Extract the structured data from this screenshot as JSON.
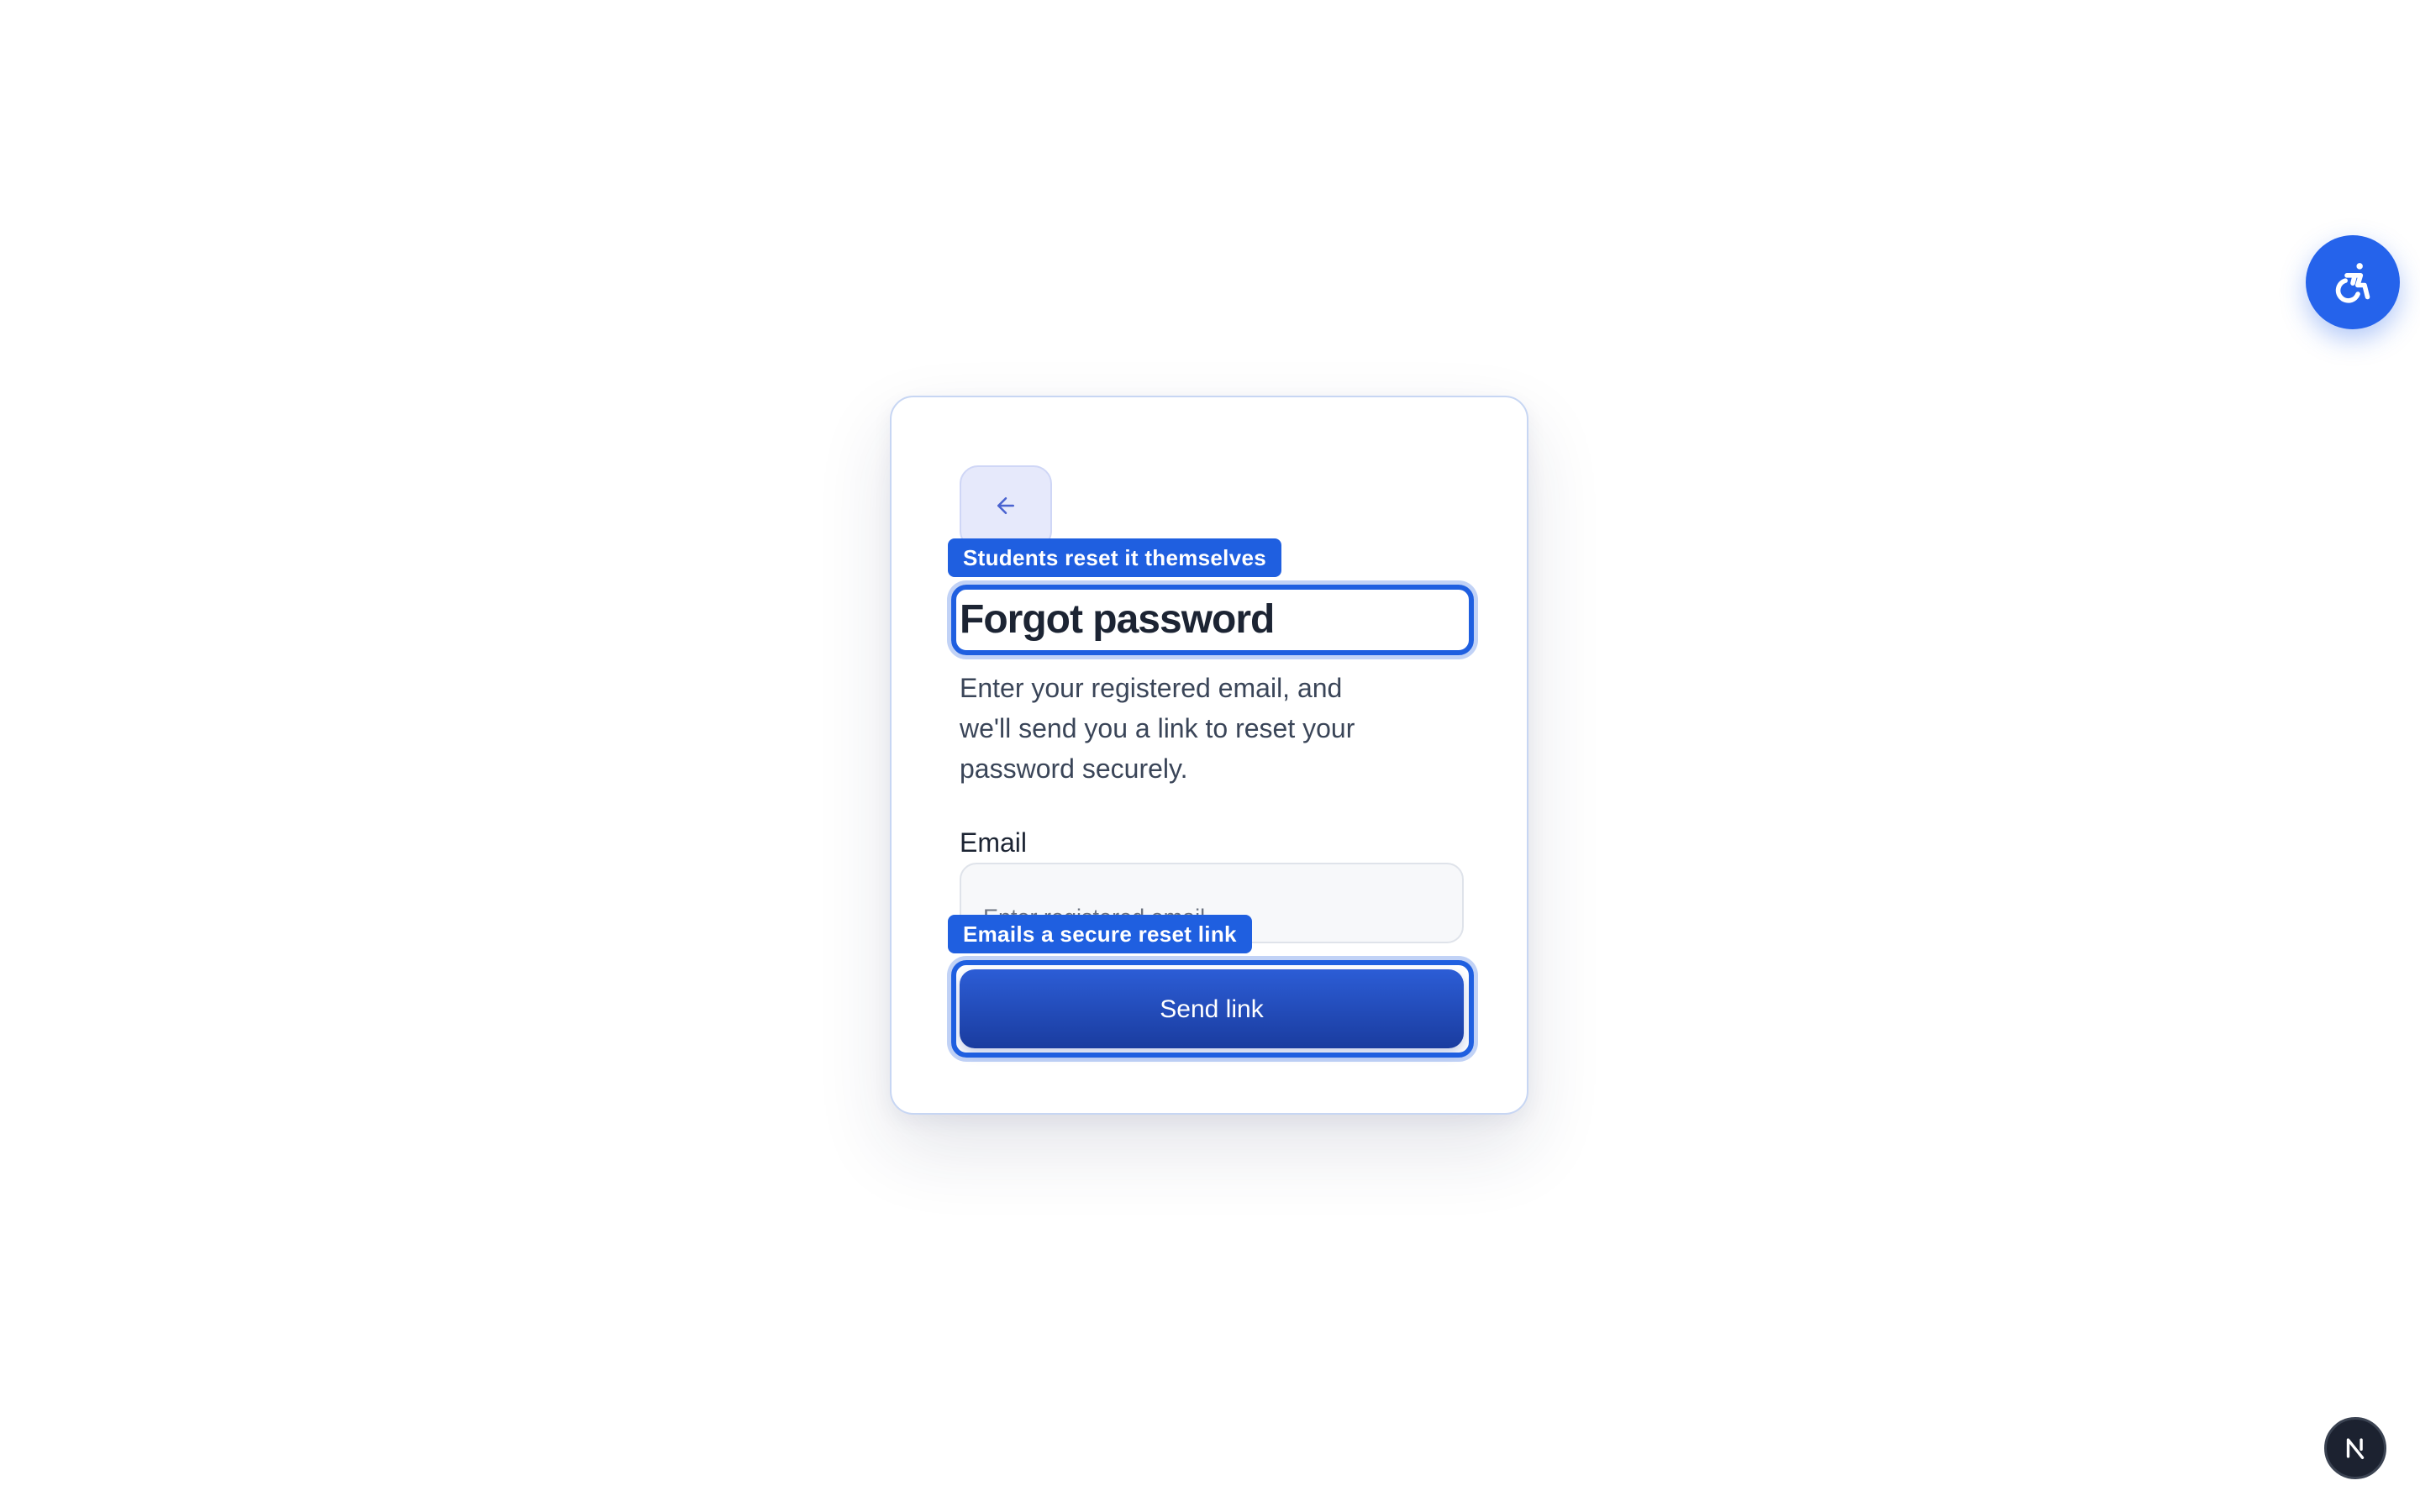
{
  "card": {
    "back_icon": "arrow-left-icon",
    "title": "Forgot password",
    "description": "Enter your registered email, and we'll send you a link to reset your password securely.",
    "email_label": "Email",
    "email_placeholder": "Enter registered email",
    "email_value": "",
    "submit_label": "Send link"
  },
  "annotations": {
    "title_badge": "Students reset it themselves",
    "button_badge": "Emails a secure reset link"
  },
  "floating": {
    "accessibility_icon": "accessibility-icon",
    "next_icon": "next-logo-icon"
  },
  "colors": {
    "accent": "#1f5fe0",
    "button_gradient_top": "#2c5dd6",
    "button_gradient_bottom": "#1a3c9f",
    "accessibility_button": "#2563eb",
    "dev_indicator": "#1c2230"
  }
}
